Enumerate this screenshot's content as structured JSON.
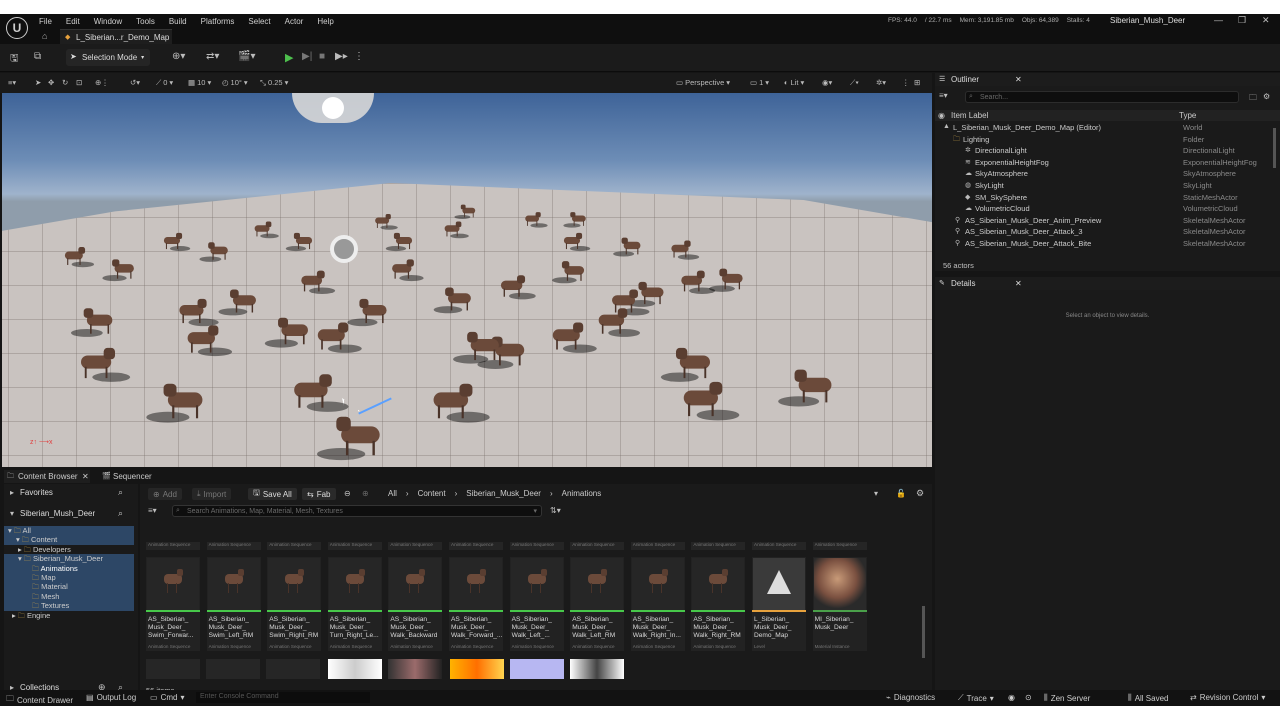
{
  "menu": [
    "File",
    "Edit",
    "Window",
    "Tools",
    "Build",
    "Platforms",
    "Select",
    "Actor",
    "Help"
  ],
  "doc_tab": "L_Siberian...r_Demo_Map",
  "stats": {
    "fps": "FPS: 44.0",
    "ms": "/ 22.7 ms",
    "mem": "Mem: 3,191.85 mb",
    "objs": "Objs: 64,389",
    "stalls": "Stalls: 4"
  },
  "project_name": "Siberian_Mush_Deer",
  "toolbar": {
    "mode": "Selection Mode"
  },
  "viewport_bar": {
    "rot_snap": "0",
    "loc_snap": "10",
    "rot_val": "10°",
    "scale": "0.25",
    "perspective": "Perspective",
    "view_count": "1",
    "lit": "Lit"
  },
  "outliner": {
    "title": "Outliner",
    "search_placeholder": "Search...",
    "col_label": "Item Label",
    "col_type": "Type",
    "rows": [
      {
        "label": "L_Siberian_Musk_Deer_Demo_Map (Editor)",
        "type": "World",
        "icon": "map-icon"
      },
      {
        "label": "Lighting",
        "type": "Folder",
        "icon": "folder-icon"
      },
      {
        "label": "DirectionalLight",
        "type": "DirectionalLight",
        "icon": "sun-icon"
      },
      {
        "label": "ExponentialHeightFog",
        "type": "ExponentialHeightFog",
        "icon": "fog-icon"
      },
      {
        "label": "SkyAtmosphere",
        "type": "SkyAtmosphere",
        "icon": "sky-icon"
      },
      {
        "label": "SkyLight",
        "type": "SkyLight",
        "icon": "light-icon"
      },
      {
        "label": "SM_SkySphere",
        "type": "StaticMeshActor",
        "icon": "mesh-icon"
      },
      {
        "label": "VolumetricCloud",
        "type": "VolumetricCloud",
        "icon": "cloud-icon"
      },
      {
        "label": "AS_Siberian_Musk_Deer_Anim_Preview",
        "type": "SkeletalMeshActor",
        "icon": "skeleton-icon"
      },
      {
        "label": "AS_Siberian_Musk_Deer_Attack_3",
        "type": "SkeletalMeshActor",
        "icon": "skeleton-icon"
      },
      {
        "label": "AS_Siberian_Musk_Deer_Attack_Bite",
        "type": "SkeletalMeshActor",
        "icon": "skeleton-icon"
      }
    ],
    "count": "56 actors"
  },
  "details": {
    "title": "Details",
    "empty_msg": "Select an object to view details."
  },
  "content_browser": {
    "tab": "Content Browser",
    "tab2": "Sequencer",
    "favorites": "Favorites",
    "root_label": "Siberian_Mush_Deer",
    "tree": [
      "All",
      "Content",
      "Developers",
      "Siberian_Musk_Deer",
      "Animations",
      "Map",
      "Material",
      "Mesh",
      "Textures",
      "Engine"
    ],
    "collections": "Collections",
    "add": "Add",
    "import": "Import",
    "save_all": "Save All",
    "fab": "Fab",
    "crumbs": [
      "All",
      "Content",
      "Siberian_Musk_Deer",
      "Animations"
    ],
    "search_placeholder": "Search Animations, Map, Material, Mesh, Textures",
    "asset_type_header": "Animation Sequence",
    "items_count": "56 items",
    "assets": [
      {
        "name": "AS_Siberian_\nMusk_Deer_\nSwim_Forwar...",
        "sub": "Animation Sequence"
      },
      {
        "name": "AS_Siberian_\nMusk_Deer_\nSwim_Left_RM",
        "sub": "Animation Sequence"
      },
      {
        "name": "AS_Siberian_\nMusk_Deer_\nSwim_Right_RM",
        "sub": "Animation Sequence"
      },
      {
        "name": "AS_Siberian_\nMusk_Deer_\nTurn_Right_Le...",
        "sub": "Animation Sequence"
      },
      {
        "name": "AS_Siberian_\nMusk_Deer_\nWalk_Backward",
        "sub": "Animation Sequence"
      },
      {
        "name": "AS_Siberian_\nMusk_Deer_\nWalk_Forward_...",
        "sub": "Animation Sequence"
      },
      {
        "name": "AS_Siberian_\nMusk_Deer_\nWalk_Left_...",
        "sub": "Animation Sequence"
      },
      {
        "name": "AS_Siberian_\nMusk_Deer_\nWalk_Left_RM",
        "sub": "Animation Sequence"
      },
      {
        "name": "AS_Siberian_\nMusk_Deer_\nWalk_Right_In...",
        "sub": "Animation Sequence"
      },
      {
        "name": "AS_Siberian_\nMusk_Deer_\nWalk_Right_RM",
        "sub": "Animation Sequence"
      },
      {
        "name": "L_Siberian_\nMusk_Deer_\nDemo_Map",
        "sub": "Level"
      },
      {
        "name": "MI_Siberian_\nMusk_Deer",
        "sub": "Material Instance"
      }
    ]
  },
  "statusbar": {
    "content_drawer": "Content Drawer",
    "output_log": "Output Log",
    "cmd": "Cmd",
    "console_placeholder": "Enter Console Command",
    "diagnostics": "Diagnostics",
    "trace": "Trace",
    "zen": "Zen Server",
    "all_saved": "All Saved",
    "revision": "Revision Control"
  }
}
